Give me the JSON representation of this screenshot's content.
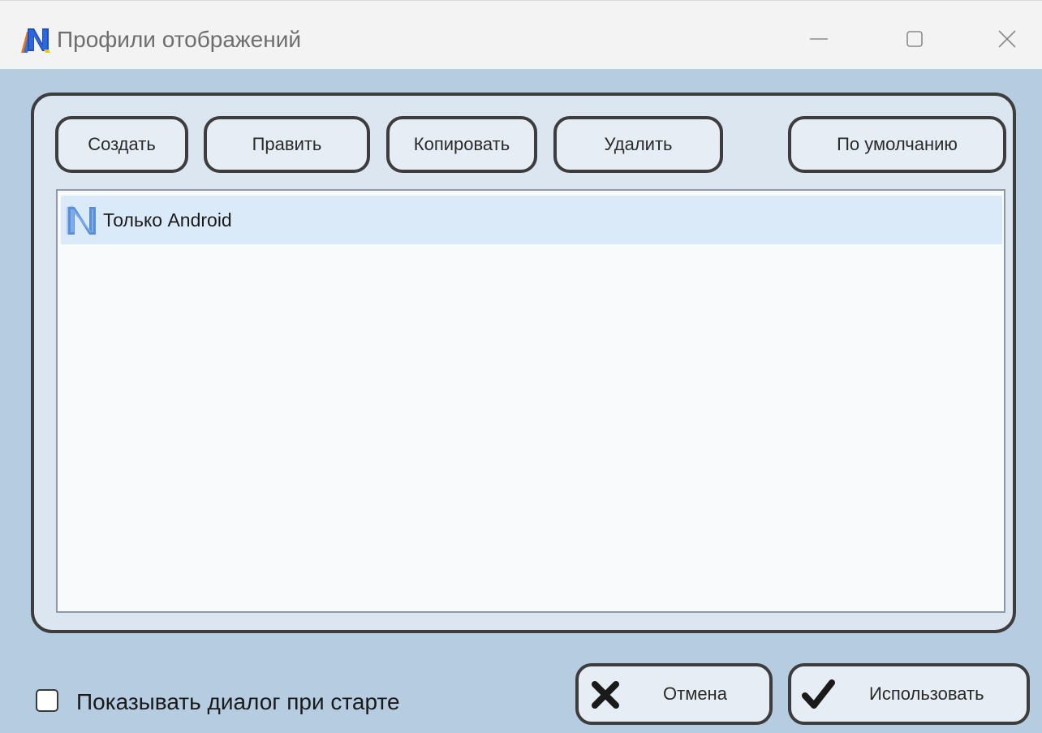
{
  "window": {
    "title": "Профили отображений",
    "icon": "app-logo-icon",
    "controls": {
      "minimize_icon": "minimize-icon",
      "maximize_icon": "maximize-icon",
      "close_icon": "close-icon"
    }
  },
  "toolbar": {
    "create_label": "Создать",
    "edit_label": "Править",
    "copy_label": "Копировать",
    "delete_label": "Удалить",
    "default_label": "По умолчанию"
  },
  "profiles": [
    {
      "label": "Только Android",
      "icon": "profile-icon",
      "selected": true
    }
  ],
  "footer": {
    "show_dialog_label": "Показывать диалог при старте",
    "show_dialog_checked": false,
    "cancel_label": "Отмена",
    "cancel_icon": "cross-icon",
    "apply_label": "Использовать",
    "apply_icon": "checkmark-icon"
  },
  "colors": {
    "window_bg": "#b6cce0",
    "panel_bg": "#dce6f0",
    "selection_bg": "#dbeaf9",
    "border": "#3d3d3d"
  }
}
